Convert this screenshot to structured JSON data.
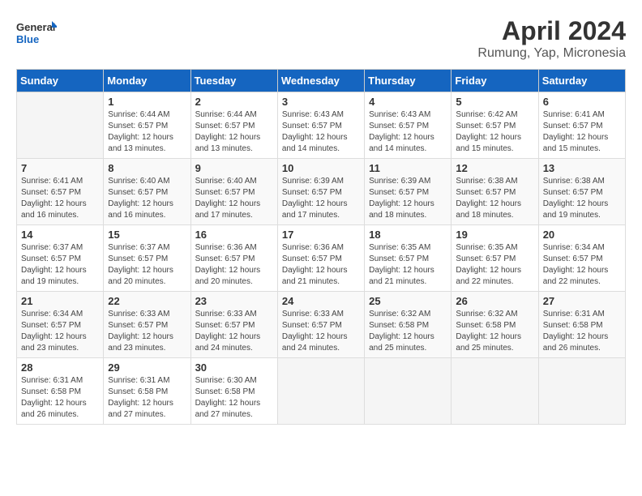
{
  "logo": {
    "line1": "General",
    "line2": "Blue"
  },
  "title": "April 2024",
  "subtitle": "Rumung, Yap, Micronesia",
  "headers": [
    "Sunday",
    "Monday",
    "Tuesday",
    "Wednesday",
    "Thursday",
    "Friday",
    "Saturday"
  ],
  "weeks": [
    [
      {
        "day": "",
        "info": ""
      },
      {
        "day": "1",
        "info": "Sunrise: 6:44 AM\nSunset: 6:57 PM\nDaylight: 12 hours\nand 13 minutes."
      },
      {
        "day": "2",
        "info": "Sunrise: 6:44 AM\nSunset: 6:57 PM\nDaylight: 12 hours\nand 13 minutes."
      },
      {
        "day": "3",
        "info": "Sunrise: 6:43 AM\nSunset: 6:57 PM\nDaylight: 12 hours\nand 14 minutes."
      },
      {
        "day": "4",
        "info": "Sunrise: 6:43 AM\nSunset: 6:57 PM\nDaylight: 12 hours\nand 14 minutes."
      },
      {
        "day": "5",
        "info": "Sunrise: 6:42 AM\nSunset: 6:57 PM\nDaylight: 12 hours\nand 15 minutes."
      },
      {
        "day": "6",
        "info": "Sunrise: 6:41 AM\nSunset: 6:57 PM\nDaylight: 12 hours\nand 15 minutes."
      }
    ],
    [
      {
        "day": "7",
        "info": "Sunrise: 6:41 AM\nSunset: 6:57 PM\nDaylight: 12 hours\nand 16 minutes."
      },
      {
        "day": "8",
        "info": "Sunrise: 6:40 AM\nSunset: 6:57 PM\nDaylight: 12 hours\nand 16 minutes."
      },
      {
        "day": "9",
        "info": "Sunrise: 6:40 AM\nSunset: 6:57 PM\nDaylight: 12 hours\nand 17 minutes."
      },
      {
        "day": "10",
        "info": "Sunrise: 6:39 AM\nSunset: 6:57 PM\nDaylight: 12 hours\nand 17 minutes."
      },
      {
        "day": "11",
        "info": "Sunrise: 6:39 AM\nSunset: 6:57 PM\nDaylight: 12 hours\nand 18 minutes."
      },
      {
        "day": "12",
        "info": "Sunrise: 6:38 AM\nSunset: 6:57 PM\nDaylight: 12 hours\nand 18 minutes."
      },
      {
        "day": "13",
        "info": "Sunrise: 6:38 AM\nSunset: 6:57 PM\nDaylight: 12 hours\nand 19 minutes."
      }
    ],
    [
      {
        "day": "14",
        "info": "Sunrise: 6:37 AM\nSunset: 6:57 PM\nDaylight: 12 hours\nand 19 minutes."
      },
      {
        "day": "15",
        "info": "Sunrise: 6:37 AM\nSunset: 6:57 PM\nDaylight: 12 hours\nand 20 minutes."
      },
      {
        "day": "16",
        "info": "Sunrise: 6:36 AM\nSunset: 6:57 PM\nDaylight: 12 hours\nand 20 minutes."
      },
      {
        "day": "17",
        "info": "Sunrise: 6:36 AM\nSunset: 6:57 PM\nDaylight: 12 hours\nand 21 minutes."
      },
      {
        "day": "18",
        "info": "Sunrise: 6:35 AM\nSunset: 6:57 PM\nDaylight: 12 hours\nand 21 minutes."
      },
      {
        "day": "19",
        "info": "Sunrise: 6:35 AM\nSunset: 6:57 PM\nDaylight: 12 hours\nand 22 minutes."
      },
      {
        "day": "20",
        "info": "Sunrise: 6:34 AM\nSunset: 6:57 PM\nDaylight: 12 hours\nand 22 minutes."
      }
    ],
    [
      {
        "day": "21",
        "info": "Sunrise: 6:34 AM\nSunset: 6:57 PM\nDaylight: 12 hours\nand 23 minutes."
      },
      {
        "day": "22",
        "info": "Sunrise: 6:33 AM\nSunset: 6:57 PM\nDaylight: 12 hours\nand 23 minutes."
      },
      {
        "day": "23",
        "info": "Sunrise: 6:33 AM\nSunset: 6:57 PM\nDaylight: 12 hours\nand 24 minutes."
      },
      {
        "day": "24",
        "info": "Sunrise: 6:33 AM\nSunset: 6:57 PM\nDaylight: 12 hours\nand 24 minutes."
      },
      {
        "day": "25",
        "info": "Sunrise: 6:32 AM\nSunset: 6:58 PM\nDaylight: 12 hours\nand 25 minutes."
      },
      {
        "day": "26",
        "info": "Sunrise: 6:32 AM\nSunset: 6:58 PM\nDaylight: 12 hours\nand 25 minutes."
      },
      {
        "day": "27",
        "info": "Sunrise: 6:31 AM\nSunset: 6:58 PM\nDaylight: 12 hours\nand 26 minutes."
      }
    ],
    [
      {
        "day": "28",
        "info": "Sunrise: 6:31 AM\nSunset: 6:58 PM\nDaylight: 12 hours\nand 26 minutes."
      },
      {
        "day": "29",
        "info": "Sunrise: 6:31 AM\nSunset: 6:58 PM\nDaylight: 12 hours\nand 27 minutes."
      },
      {
        "day": "30",
        "info": "Sunrise: 6:30 AM\nSunset: 6:58 PM\nDaylight: 12 hours\nand 27 minutes."
      },
      {
        "day": "",
        "info": ""
      },
      {
        "day": "",
        "info": ""
      },
      {
        "day": "",
        "info": ""
      },
      {
        "day": "",
        "info": ""
      }
    ]
  ]
}
